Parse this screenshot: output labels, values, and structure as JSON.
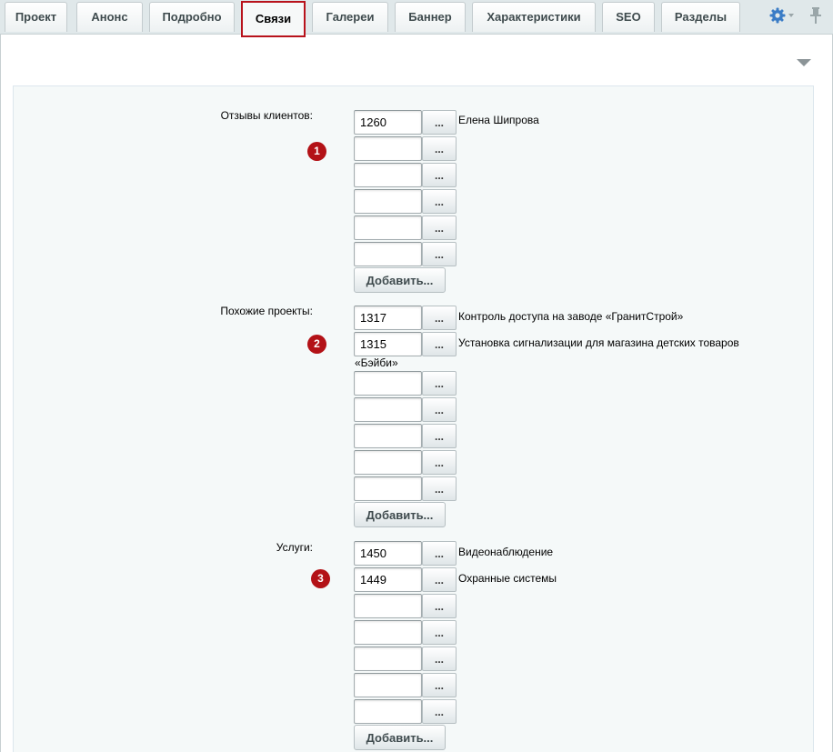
{
  "tabs": [
    {
      "label": "Проект"
    },
    {
      "label": "Анонс"
    },
    {
      "label": "Подробно"
    },
    {
      "label": "Связи"
    },
    {
      "label": "Галереи"
    },
    {
      "label": "Баннер"
    },
    {
      "label": "Характеристики"
    },
    {
      "label": "SEO"
    },
    {
      "label": "Разделы"
    }
  ],
  "active_tab": "Связи",
  "icons": {
    "settings": "gear-icon",
    "pin": "pin-icon",
    "collapse": "triangle-down-icon"
  },
  "colors": {
    "accent": "#b31217",
    "tab_text": "#3f4b4e",
    "panel_bg": "#f5f9f9"
  },
  "browse_label": "...",
  "add_label": "Добавить...",
  "fields": {
    "reviews": {
      "label": "Отзывы клиентов:",
      "badge": "1",
      "rows": [
        {
          "value": "1260",
          "name": "Елена Шипрова"
        },
        {
          "value": "",
          "name": ""
        },
        {
          "value": "",
          "name": ""
        },
        {
          "value": "",
          "name": ""
        },
        {
          "value": "",
          "name": ""
        },
        {
          "value": "",
          "name": ""
        }
      ]
    },
    "similar": {
      "label": "Похожие проекты:",
      "badge": "2",
      "rows": [
        {
          "value": "1317",
          "name": "Контроль доступа на заводе «ГранитСтрой»"
        },
        {
          "value": "1315",
          "name": "Установка сигнализации для магазина детских товаров",
          "name_cont": "«Бэйби»"
        },
        {
          "value": "",
          "name": ""
        },
        {
          "value": "",
          "name": ""
        },
        {
          "value": "",
          "name": ""
        },
        {
          "value": "",
          "name": ""
        },
        {
          "value": "",
          "name": ""
        }
      ]
    },
    "services": {
      "label": "Услуги:",
      "badge": "3",
      "rows": [
        {
          "value": "1450",
          "name": "Видеонаблюдение"
        },
        {
          "value": "1449",
          "name": "Охранные системы"
        },
        {
          "value": "",
          "name": ""
        },
        {
          "value": "",
          "name": ""
        },
        {
          "value": "",
          "name": ""
        },
        {
          "value": "",
          "name": ""
        },
        {
          "value": "",
          "name": ""
        }
      ]
    }
  }
}
